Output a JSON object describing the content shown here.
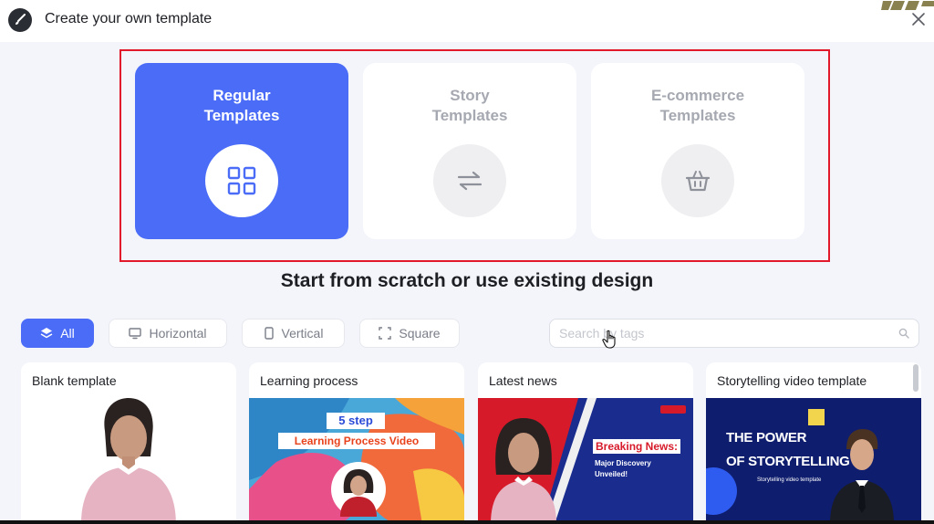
{
  "header": {
    "title": "Create your own template",
    "brush_icon": "brush-icon",
    "close_icon": "close-icon"
  },
  "template_types": [
    {
      "label": "Regular\nTemplates",
      "icon": "grid-icon",
      "active": true
    },
    {
      "label": "Story\nTemplates",
      "icon": "swap-arrows-icon",
      "active": false
    },
    {
      "label": "E-commerce\nTemplates",
      "icon": "basket-icon",
      "active": false
    }
  ],
  "section_heading": "Start from scratch or use existing design",
  "filters": [
    {
      "label": "All",
      "icon": "layers-icon",
      "active": true
    },
    {
      "label": "Horizontal",
      "icon": "monitor-icon",
      "active": false
    },
    {
      "label": "Vertical",
      "icon": "phone-icon",
      "active": false
    },
    {
      "label": "Square",
      "icon": "square-frame-icon",
      "active": false
    }
  ],
  "search": {
    "placeholder": "Search by tags",
    "value": ""
  },
  "templates": [
    {
      "title": "Blank template"
    },
    {
      "title": "Learning process",
      "thumb_text_1": "5 step",
      "thumb_text_2": "Learning Process Video"
    },
    {
      "title": "Latest news",
      "thumb_text_1": "Breaking News:",
      "thumb_text_2": "Major Discovery Unveiled!"
    },
    {
      "title": "Storytelling video template",
      "thumb_text_1": "THE POWER",
      "thumb_text_2": "OF STORYTELLING",
      "thumb_text_3": "Storytelling video template"
    }
  ],
  "colors": {
    "accent": "#4a6cf7",
    "highlight": "#e2192b",
    "background": "#f3f5fb"
  }
}
